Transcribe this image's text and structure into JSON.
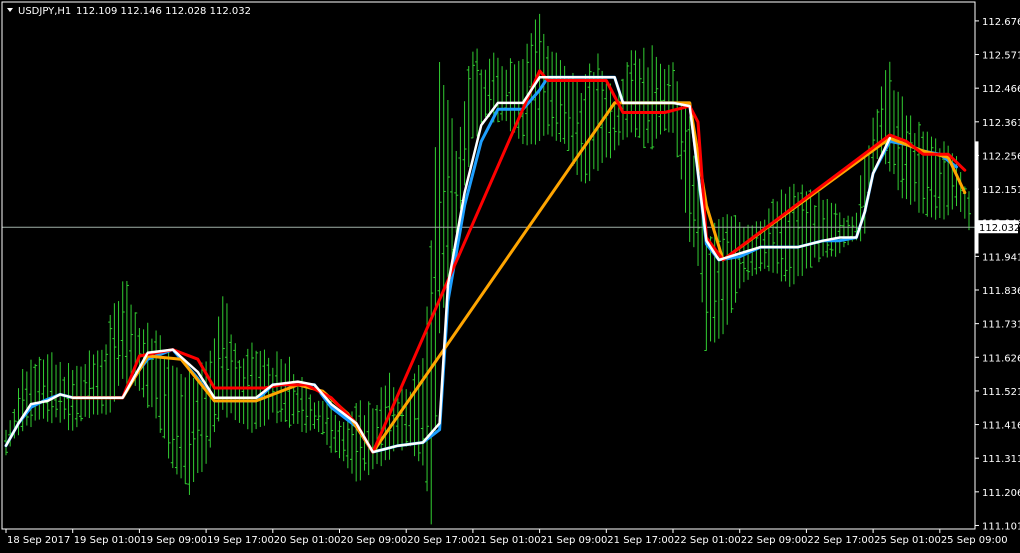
{
  "header": {
    "symbol": "USDJPY,H1",
    "ohlc": "112.109 112.146 112.028 112.032"
  },
  "colors": {
    "background": "#000000",
    "frame": "#ffffff",
    "candle": "#32cd32",
    "line_white": "#ffffff",
    "line_blue": "#1e9fff",
    "line_red": "#ff0000",
    "line_orange": "#ffa500",
    "bid_line": "#9fb0a8",
    "text": "#ffffff"
  },
  "chart_data": {
    "type": "line",
    "title": "USDJPY,H1",
    "y_axis_side": "right",
    "ylim": [
      111.09,
      112.735
    ],
    "y_ticks": [
      "112.676",
      "112.571",
      "112.466",
      "112.361",
      "112.256",
      "112.151",
      "112.046",
      "111.941",
      "111.836",
      "111.731",
      "111.626",
      "111.521",
      "111.416",
      "111.311",
      "111.206",
      "111.101"
    ],
    "x_ticks": [
      "18 Sep 2017",
      "19 Sep 01:00",
      "19 Sep 09:00",
      "19 Sep 17:00",
      "20 Sep 01:00",
      "20 Sep 09:00",
      "20 Sep 17:00",
      "21 Sep 01:00",
      "21 Sep 09:00",
      "21 Sep 17:00",
      "22 Sep 01:00",
      "22 Sep 09:00",
      "22 Sep 17:00",
      "25 Sep 01:00",
      "25 Sep 09:00"
    ],
    "x_tick_bars": [
      0,
      16,
      32,
      48,
      64,
      80,
      96,
      112,
      128,
      144,
      160,
      176,
      192,
      208,
      224
    ],
    "n_bars": 232,
    "bid_price": "112.032",
    "bid_value": 112.032,
    "highs": [
      [
        0,
        111.4
      ],
      [
        4,
        111.58
      ],
      [
        8,
        111.65
      ],
      [
        12,
        111.6
      ],
      [
        16,
        111.58
      ],
      [
        20,
        111.62
      ],
      [
        24,
        111.68
      ],
      [
        28,
        111.88
      ],
      [
        30,
        111.82
      ],
      [
        32,
        111.72
      ],
      [
        36,
        111.7
      ],
      [
        40,
        111.6
      ],
      [
        44,
        111.58
      ],
      [
        48,
        111.6
      ],
      [
        52,
        111.82
      ],
      [
        56,
        111.62
      ],
      [
        60,
        111.65
      ],
      [
        64,
        111.62
      ],
      [
        68,
        111.6
      ],
      [
        72,
        111.52
      ],
      [
        76,
        111.5
      ],
      [
        80,
        111.45
      ],
      [
        84,
        111.46
      ],
      [
        88,
        111.48
      ],
      [
        92,
        111.55
      ],
      [
        96,
        111.52
      ],
      [
        100,
        111.6
      ],
      [
        102,
        112.0
      ],
      [
        104,
        112.55
      ],
      [
        108,
        112.3
      ],
      [
        112,
        112.6
      ],
      [
        114,
        112.52
      ],
      [
        116,
        112.55
      ],
      [
        120,
        112.55
      ],
      [
        124,
        112.58
      ],
      [
        128,
        112.7
      ],
      [
        130,
        112.6
      ],
      [
        134,
        112.52
      ],
      [
        138,
        112.48
      ],
      [
        142,
        112.55
      ],
      [
        146,
        112.45
      ],
      [
        150,
        112.6
      ],
      [
        154,
        112.56
      ],
      [
        156,
        112.58
      ],
      [
        160,
        112.52
      ],
      [
        164,
        112.35
      ],
      [
        166,
        112.2
      ],
      [
        168,
        112.0
      ],
      [
        172,
        112.06
      ],
      [
        176,
        112.05
      ],
      [
        180,
        112.06
      ],
      [
        184,
        112.1
      ],
      [
        188,
        112.15
      ],
      [
        192,
        112.15
      ],
      [
        196,
        112.1
      ],
      [
        200,
        112.08
      ],
      [
        204,
        112.1
      ],
      [
        206,
        112.24
      ],
      [
        208,
        112.38
      ],
      [
        210,
        112.48
      ],
      [
        212,
        112.52
      ],
      [
        214,
        112.45
      ],
      [
        216,
        112.38
      ],
      [
        220,
        112.32
      ],
      [
        224,
        112.3
      ],
      [
        228,
        112.25
      ],
      [
        231,
        112.15
      ]
    ],
    "lows": [
      [
        0,
        111.32
      ],
      [
        4,
        111.4
      ],
      [
        8,
        111.42
      ],
      [
        12,
        111.44
      ],
      [
        16,
        111.4
      ],
      [
        20,
        111.45
      ],
      [
        24,
        111.44
      ],
      [
        28,
        111.55
      ],
      [
        30,
        111.55
      ],
      [
        32,
        111.52
      ],
      [
        36,
        111.44
      ],
      [
        40,
        111.28
      ],
      [
        44,
        111.2
      ],
      [
        48,
        111.3
      ],
      [
        52,
        111.46
      ],
      [
        56,
        111.42
      ],
      [
        60,
        111.4
      ],
      [
        64,
        111.44
      ],
      [
        68,
        111.42
      ],
      [
        72,
        111.4
      ],
      [
        76,
        111.38
      ],
      [
        80,
        111.3
      ],
      [
        84,
        111.25
      ],
      [
        88,
        111.27
      ],
      [
        92,
        111.32
      ],
      [
        96,
        111.35
      ],
      [
        100,
        111.3
      ],
      [
        102,
        111.1
      ],
      [
        104,
        111.7
      ],
      [
        108,
        112.0
      ],
      [
        112,
        112.3
      ],
      [
        114,
        112.36
      ],
      [
        116,
        112.38
      ],
      [
        120,
        112.35
      ],
      [
        124,
        112.28
      ],
      [
        128,
        112.3
      ],
      [
        130,
        112.32
      ],
      [
        134,
        112.3
      ],
      [
        138,
        112.16
      ],
      [
        142,
        112.22
      ],
      [
        146,
        112.26
      ],
      [
        150,
        112.32
      ],
      [
        154,
        112.28
      ],
      [
        156,
        112.3
      ],
      [
        160,
        112.34
      ],
      [
        164,
        112.0
      ],
      [
        166,
        111.92
      ],
      [
        168,
        111.66
      ],
      [
        172,
        111.7
      ],
      [
        176,
        111.84
      ],
      [
        180,
        111.88
      ],
      [
        184,
        111.9
      ],
      [
        188,
        111.85
      ],
      [
        192,
        111.9
      ],
      [
        196,
        111.95
      ],
      [
        200,
        111.95
      ],
      [
        204,
        111.98
      ],
      [
        206,
        112.02
      ],
      [
        208,
        112.2
      ],
      [
        210,
        112.26
      ],
      [
        212,
        112.22
      ],
      [
        214,
        112.15
      ],
      [
        216,
        112.12
      ],
      [
        220,
        112.08
      ],
      [
        224,
        112.05
      ],
      [
        228,
        112.1
      ],
      [
        231,
        112.02
      ]
    ],
    "series": [
      {
        "color": "#1e9fff",
        "width": 3,
        "points": [
          [
            0,
            111.35
          ],
          [
            3,
            111.42
          ],
          [
            6,
            111.47
          ],
          [
            9,
            111.49
          ],
          [
            13,
            111.51
          ],
          [
            16,
            111.5
          ],
          [
            28,
            111.5
          ],
          [
            31,
            111.57
          ],
          [
            34,
            111.62
          ],
          [
            40,
            111.65
          ],
          [
            46,
            111.56
          ],
          [
            50,
            111.49
          ],
          [
            60,
            111.49
          ],
          [
            64,
            111.54
          ],
          [
            70,
            111.54
          ],
          [
            74,
            111.54
          ],
          [
            78,
            111.47
          ],
          [
            84,
            111.41
          ],
          [
            88,
            111.33
          ],
          [
            94,
            111.35
          ],
          [
            100,
            111.36
          ],
          [
            104,
            111.4
          ],
          [
            106,
            111.8
          ],
          [
            110,
            112.1
          ],
          [
            114,
            112.3
          ],
          [
            118,
            112.4
          ],
          [
            124,
            112.4
          ],
          [
            128,
            112.46
          ],
          [
            130,
            112.5
          ],
          [
            146,
            112.5
          ],
          [
            148,
            112.42
          ],
          [
            160,
            112.42
          ],
          [
            164,
            112.42
          ],
          [
            168,
            111.98
          ],
          [
            171,
            111.93
          ],
          [
            176,
            111.94
          ],
          [
            181,
            111.97
          ],
          [
            190,
            111.97
          ],
          [
            196,
            111.99
          ],
          [
            200,
            111.99
          ],
          [
            204,
            112.0
          ],
          [
            206,
            112.08
          ],
          [
            208,
            112.2
          ],
          [
            212,
            112.3
          ],
          [
            216,
            112.29
          ],
          [
            220,
            112.27
          ],
          [
            224,
            112.26
          ],
          [
            228,
            112.22
          ]
        ]
      },
      {
        "color": "#ffa500",
        "width": 3,
        "points": [
          [
            16,
            111.5
          ],
          [
            28,
            111.5
          ],
          [
            34,
            111.63
          ],
          [
            42,
            111.62
          ],
          [
            50,
            111.49
          ],
          [
            60,
            111.49
          ],
          [
            70,
            111.54
          ],
          [
            76,
            111.52
          ],
          [
            82,
            111.45
          ],
          [
            88,
            111.33
          ],
          [
            146,
            112.42
          ],
          [
            164,
            112.42
          ],
          [
            168,
            112.1
          ],
          [
            172,
            111.93
          ],
          [
            212,
            112.31
          ],
          [
            220,
            112.27
          ],
          [
            226,
            112.25
          ],
          [
            230,
            112.14
          ]
        ]
      },
      {
        "color": "#ff0000",
        "width": 3,
        "points": [
          [
            16,
            111.5
          ],
          [
            28,
            111.5
          ],
          [
            32,
            111.63
          ],
          [
            40,
            111.65
          ],
          [
            46,
            111.62
          ],
          [
            50,
            111.53
          ],
          [
            62,
            111.53
          ],
          [
            66,
            111.54
          ],
          [
            72,
            111.54
          ],
          [
            78,
            111.5
          ],
          [
            84,
            111.42
          ],
          [
            88,
            111.33
          ],
          [
            128,
            112.52
          ],
          [
            130,
            112.49
          ],
          [
            144,
            112.49
          ],
          [
            148,
            112.39
          ],
          [
            158,
            112.39
          ],
          [
            164,
            112.41
          ],
          [
            166,
            112.36
          ],
          [
            168,
            112.0
          ],
          [
            172,
            111.93
          ],
          [
            212,
            112.32
          ],
          [
            216,
            112.3
          ],
          [
            220,
            112.26
          ],
          [
            226,
            112.26
          ],
          [
            230,
            112.21
          ]
        ]
      },
      {
        "color": "#ffffff",
        "width": 2.5,
        "points": [
          [
            0,
            111.35
          ],
          [
            3,
            111.42
          ],
          [
            6,
            111.48
          ],
          [
            10,
            111.49
          ],
          [
            13,
            111.51
          ],
          [
            16,
            111.5
          ],
          [
            28,
            111.5
          ],
          [
            31,
            111.57
          ],
          [
            34,
            111.64
          ],
          [
            40,
            111.65
          ],
          [
            46,
            111.58
          ],
          [
            50,
            111.5
          ],
          [
            60,
            111.5
          ],
          [
            64,
            111.54
          ],
          [
            70,
            111.55
          ],
          [
            74,
            111.54
          ],
          [
            78,
            111.48
          ],
          [
            84,
            111.42
          ],
          [
            88,
            111.33
          ],
          [
            94,
            111.35
          ],
          [
            100,
            111.36
          ],
          [
            104,
            111.42
          ],
          [
            106,
            111.85
          ],
          [
            110,
            112.14
          ],
          [
            114,
            112.35
          ],
          [
            118,
            112.42
          ],
          [
            124,
            112.42
          ],
          [
            128,
            112.5
          ],
          [
            130,
            112.5
          ],
          [
            146,
            112.5
          ],
          [
            148,
            112.42
          ],
          [
            160,
            112.42
          ],
          [
            164,
            112.41
          ],
          [
            168,
            111.99
          ],
          [
            171,
            111.93
          ],
          [
            176,
            111.95
          ],
          [
            181,
            111.97
          ],
          [
            190,
            111.97
          ],
          [
            196,
            111.99
          ],
          [
            200,
            112.0
          ],
          [
            204,
            112.0
          ],
          [
            206,
            112.08
          ],
          [
            208,
            112.2
          ],
          [
            212,
            112.31
          ]
        ]
      }
    ]
  }
}
